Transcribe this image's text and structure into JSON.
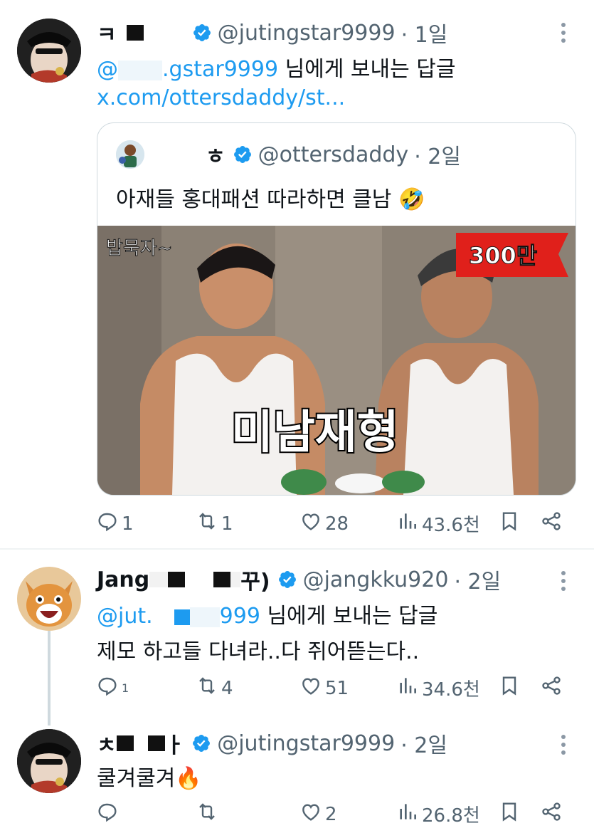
{
  "tweets": [
    {
      "name": "ㅋ",
      "handle": "@jutingstar9999",
      "time": "· 1일",
      "reply_to_prefix": "@",
      "reply_to_handle": ".gstar9999",
      "reply_to_suffix": " 님에게 보내는 답글",
      "text": "x.com/ottersdaddy/st...",
      "stats": {
        "replies": "1",
        "retweets": "1",
        "likes": "28",
        "views": "43.6천"
      }
    },
    {
      "name": "Jang",
      "name_end": "꾸)",
      "handle": "@jangkku920",
      "time": "· 2일",
      "reply_to_prefix": "@jut.",
      "reply_to_handle": "999",
      "reply_to_suffix": " 님에게 보내는 답글",
      "text": "제모 하고들 다녀라..다 쥐어뜯는다..",
      "stats": {
        "replies": "1",
        "retweets": "4",
        "likes": "51",
        "views": "34.6천"
      }
    },
    {
      "name": "ㅊ",
      "name_end": "ㅏ",
      "handle": "@jutingstar9999",
      "time": "· 2일",
      "text": "쿨겨쿨겨🔥",
      "stats": {
        "replies": "",
        "retweets": "",
        "likes": "2",
        "views": "26.8천"
      }
    }
  ],
  "quote": {
    "name_end": "ㅎ",
    "handle": "@ottersdaddy",
    "time": "· 2일",
    "text": "아재들 홍대패션 따라하면 클남 🤣",
    "image": {
      "corner_caption": "밥묵자~",
      "badge": "300만",
      "overlay": "미남재형"
    }
  },
  "icons": [
    "reply-icon",
    "retweet-icon",
    "like-icon",
    "views-icon",
    "bookmark-icon",
    "share-icon",
    "verified-icon",
    "more-icon"
  ],
  "colors": {
    "accent": "#1d9bf0",
    "muted": "#536471",
    "badge": "#e0201b"
  }
}
